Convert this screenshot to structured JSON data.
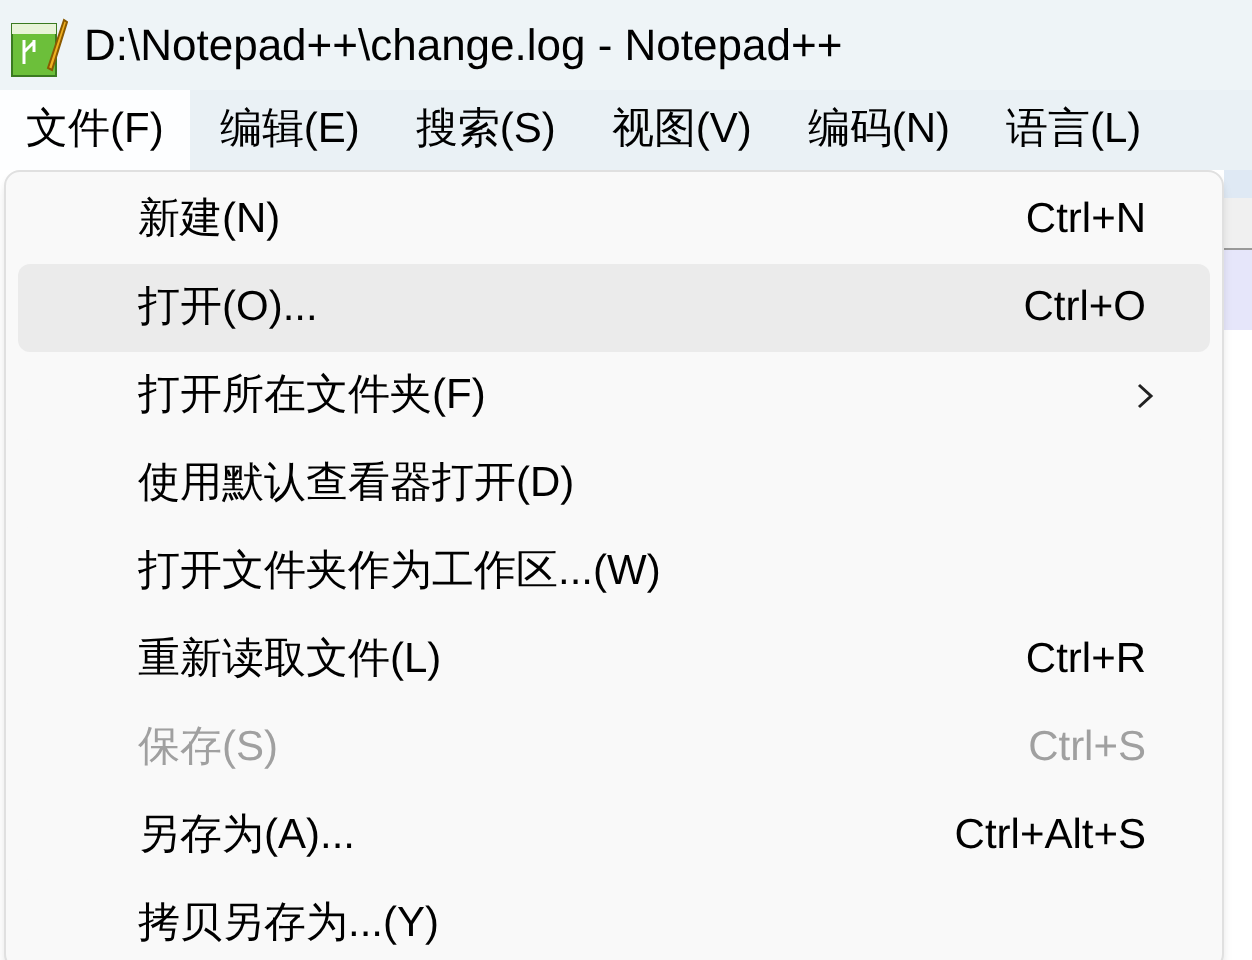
{
  "window": {
    "title": "D:\\Notepad++\\change.log - Notepad++"
  },
  "menu_bar": [
    {
      "label": "文件(F)",
      "selected": true
    },
    {
      "label": "编辑(E)",
      "selected": false
    },
    {
      "label": "搜索(S)",
      "selected": false
    },
    {
      "label": "视图(V)",
      "selected": false
    },
    {
      "label": "编码(N)",
      "selected": false
    },
    {
      "label": "语言(L)",
      "selected": false
    }
  ],
  "file_menu": [
    {
      "label": "新建(N)",
      "shortcut": "Ctrl+N",
      "disabled": false,
      "selected": false
    },
    {
      "label": "打开(O)...",
      "shortcut": "Ctrl+O",
      "disabled": false,
      "selected": true
    },
    {
      "label": "打开所在文件夹(F)",
      "submenu": true,
      "disabled": false,
      "selected": false
    },
    {
      "label": "使用默认查看器打开(D)",
      "disabled": false,
      "selected": false
    },
    {
      "label": "打开文件夹作为工作区...(W)",
      "disabled": false,
      "selected": false
    },
    {
      "label": "重新读取文件(L)",
      "shortcut": "Ctrl+R",
      "disabled": false,
      "selected": false
    },
    {
      "label": "保存(S)",
      "shortcut": "Ctrl+S",
      "disabled": true,
      "selected": false
    },
    {
      "label": "另存为(A)...",
      "shortcut": "Ctrl+Alt+S",
      "disabled": false,
      "selected": false
    },
    {
      "label": "拷贝另存为...(Y)",
      "disabled": false,
      "selected": false
    }
  ]
}
